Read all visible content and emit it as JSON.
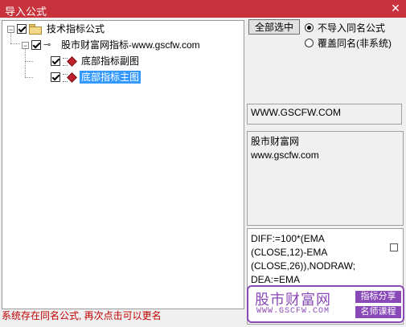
{
  "window": {
    "title": "导入公式",
    "close_glyph": "✕"
  },
  "tree": {
    "root": {
      "label": "技术指标公式",
      "expander": "−",
      "checked": true
    },
    "group": {
      "label": "股市财富网指标-www.gscfw.com",
      "expander": "−",
      "checked": true
    },
    "items": [
      {
        "label": "底部指标副图",
        "checked": true,
        "selected": false
      },
      {
        "label": "底部指标主图",
        "checked": true,
        "selected": true
      }
    ]
  },
  "status_message": "系统存在同名公式, 再次点击可以更名",
  "controls": {
    "select_all_label": "全部选中",
    "options": [
      {
        "label": "不导入同名公式",
        "selected": true
      },
      {
        "label": "覆盖同名(非系统)",
        "selected": false
      }
    ]
  },
  "source_url": "WWW.GSCFW.COM",
  "description": {
    "line1": "股市财富网",
    "line2": "www.gscfw.com"
  },
  "code_lines": [
    "DIFF:=100*(EMA",
    "(CLOSE,12)-EMA",
    "(CLOSE,26)),NODRAW;",
    "DEA:=EMA"
  ],
  "watermark": {
    "name_cn": "股市财富网",
    "url": "WWW.GSCFW.COM",
    "tag1": "指标分享",
    "tag2": "名师课程"
  },
  "colors": {
    "titlebar": "#c8323c",
    "selection": "#3399ff",
    "status_text": "#c00000",
    "watermark": "#8a49b8"
  }
}
